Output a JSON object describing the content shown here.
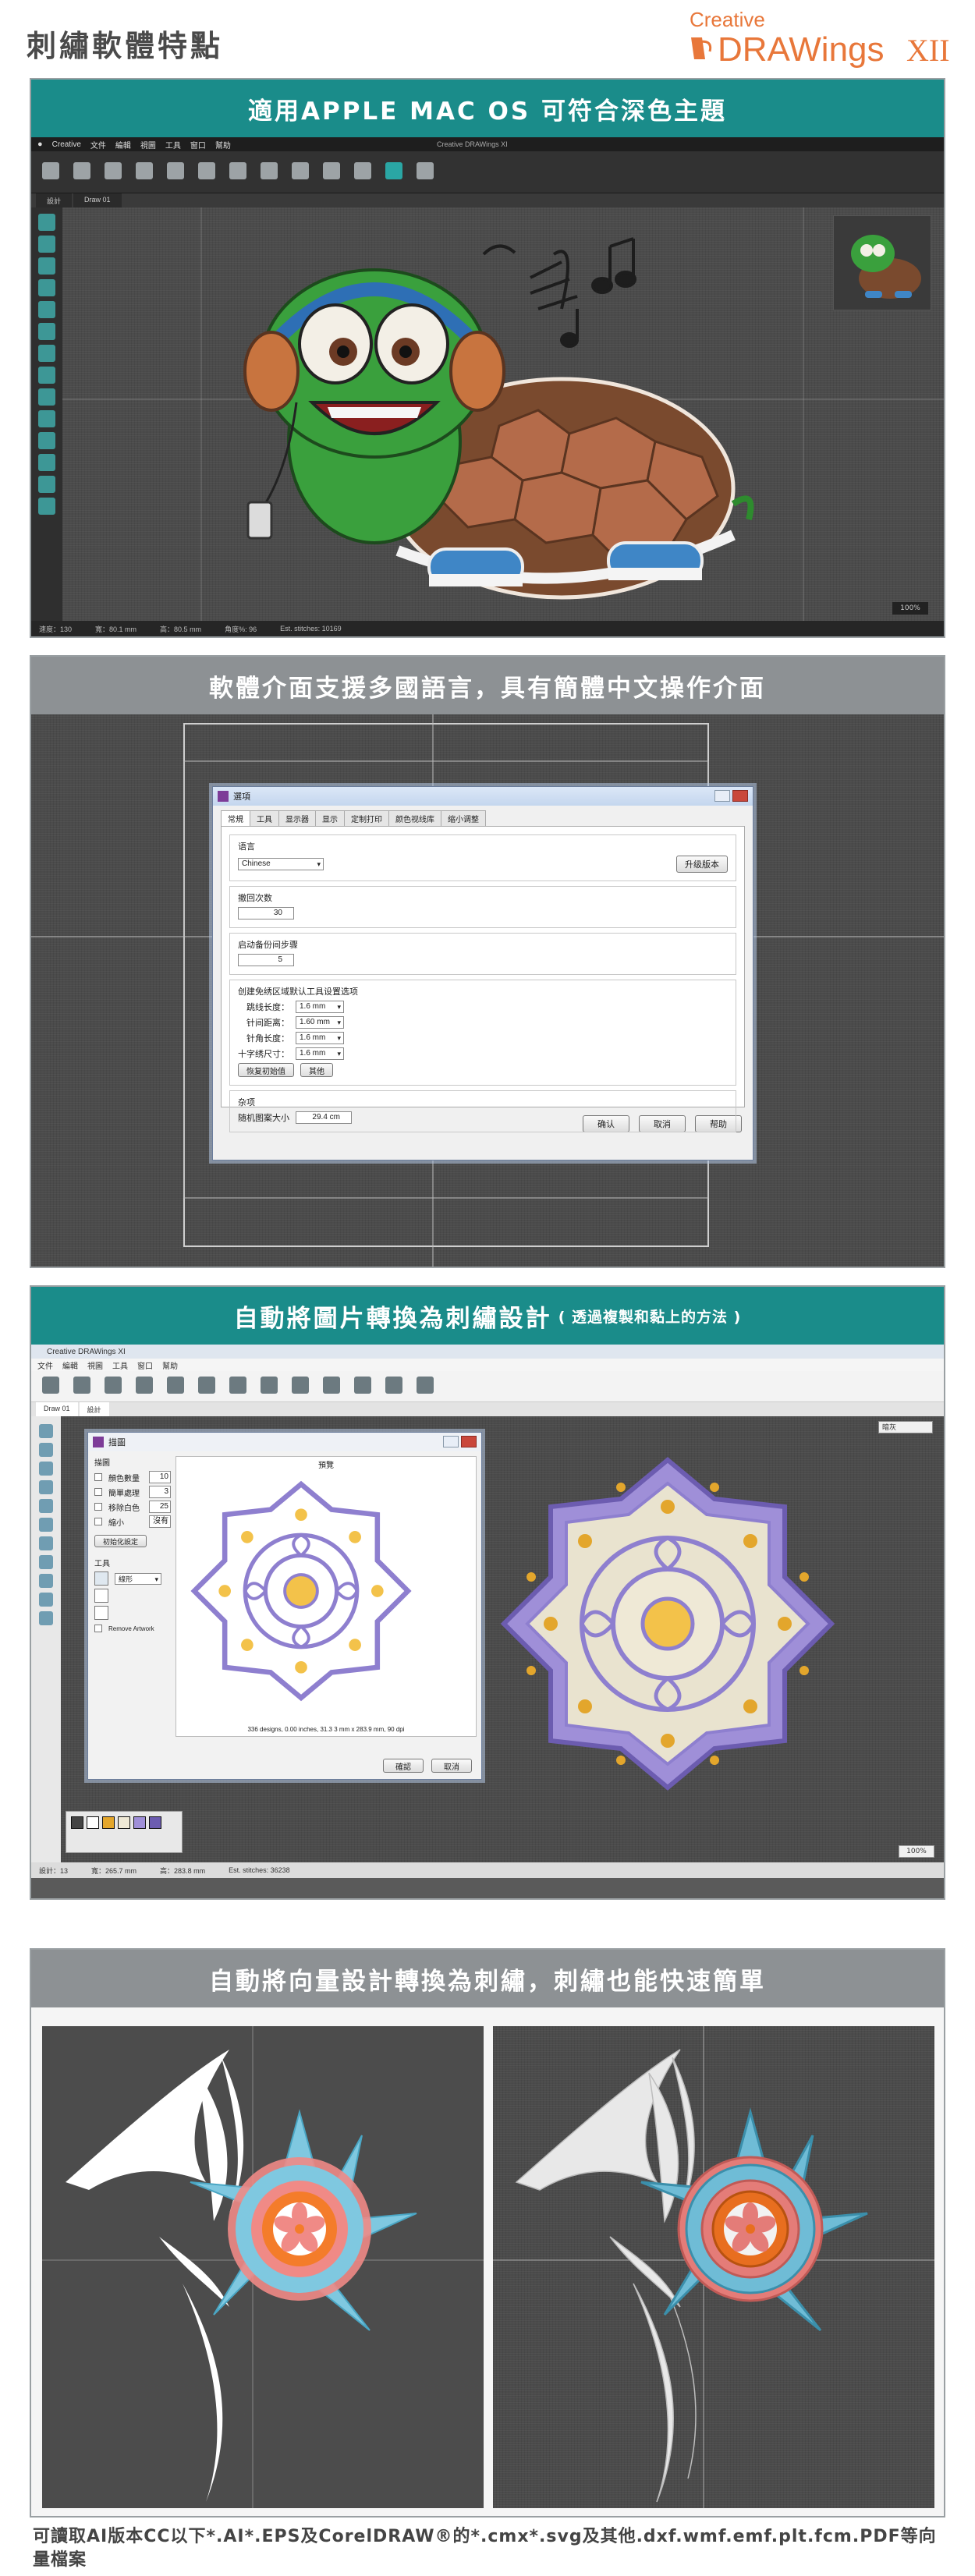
{
  "header": {
    "title": "刺繡軟體特點",
    "logo_top": "Creative",
    "logo_main": "DRAWings",
    "logo_version": "XII",
    "colors": {
      "brand": "#e8773a",
      "title": "#4a4a4a"
    }
  },
  "section1": {
    "banner": "適用APPLE MAC OS 可符合深色主題",
    "app": {
      "menu": [
        "Creative",
        "文件",
        "編輯",
        "視圖",
        "工具",
        "窗口",
        "幫助"
      ],
      "window_title": "Creative DRAWings XI",
      "tabs": [
        "設計",
        "Draw 01"
      ],
      "status": [
        "速度：130",
        "寬：80.1 mm",
        "高：80.5 mm",
        "角度%: 96",
        "Est. stitches: 10169"
      ],
      "zoom": "100%"
    }
  },
  "section2": {
    "banner": "軟體介面支援多國語言，具有簡體中文操作介面",
    "dialog": {
      "title": "選項",
      "tabs": [
        "常規",
        "工具",
        "显示器",
        "显示",
        "定制打印",
        "颜色视线库",
        "缩小调整"
      ],
      "language_label": "语言",
      "language_value": "Chinese",
      "upgrade_button": "升级版本",
      "undo_label": "撤回次数",
      "undo_value": "30",
      "autosave_label": "启动备份间步骤",
      "autosave_value": "5",
      "defaults_label": "创建免绣区域默认工具设置选项",
      "rows": [
        {
          "label": "跳线长度：",
          "value": "1.6 mm"
        },
        {
          "label": "针间距离：",
          "value": "1.60 mm"
        },
        {
          "label": "针角长度：",
          "value": "1.6 mm"
        },
        {
          "label": "十字绣尺寸：",
          "value": "1.6 mm"
        }
      ],
      "reset_button": "恢复初始值",
      "import_button": "其他",
      "misc_label": "杂项",
      "hoop_label": "随机图案大小",
      "hoop_value": "29.4 cm",
      "ok": "确认",
      "cancel": "取消",
      "help": "帮助"
    }
  },
  "section3": {
    "banner": "自動將圖片轉換為刺繡設計",
    "banner_sub": "( 透過複製和黏上的方法 )",
    "app": {
      "window_title": "Creative DRAWings XI",
      "menu": [
        "文件",
        "編輯",
        "視圖",
        "工具",
        "窗口",
        "幫助"
      ],
      "tabs": [
        "Draw 01",
        "設計"
      ],
      "status": [
        "設計：13",
        "寬：265.7 mm",
        "高：283.8 mm",
        "Est. stitches: 36238"
      ],
      "zoom": "100%",
      "dropdown": "暗灰"
    },
    "dialog": {
      "title": "描圖",
      "preview_label": "預覽",
      "section_options": "描圖",
      "checks": [
        {
          "label": "顏色數量",
          "value": "10"
        },
        {
          "label": "簡單處理",
          "value": "3"
        },
        {
          "label": "移除白色",
          "value": "25"
        },
        {
          "label": "縮小",
          "value": "沒有"
        }
      ],
      "reset_button": "初始化設定",
      "tools_label": "工具",
      "tool_value": "線形",
      "remove_bg": "Remove Artwork",
      "info": "336 designs, 0.00 inches, 31.3 3 mm x 283.9 mm, 90 dpi",
      "ok": "確認",
      "cancel": "取消"
    }
  },
  "section4": {
    "banner": "自動將向量設計轉換為刺繡，刺繡也能快速簡單"
  },
  "footnote": {
    "text": "可讀取AI版本CC以下*.AI*.EPS及CorelDRAW®的*.cmx*.svg及其他.dxf.wmf.emf.plt.fcm.PDF等向量檔案"
  }
}
